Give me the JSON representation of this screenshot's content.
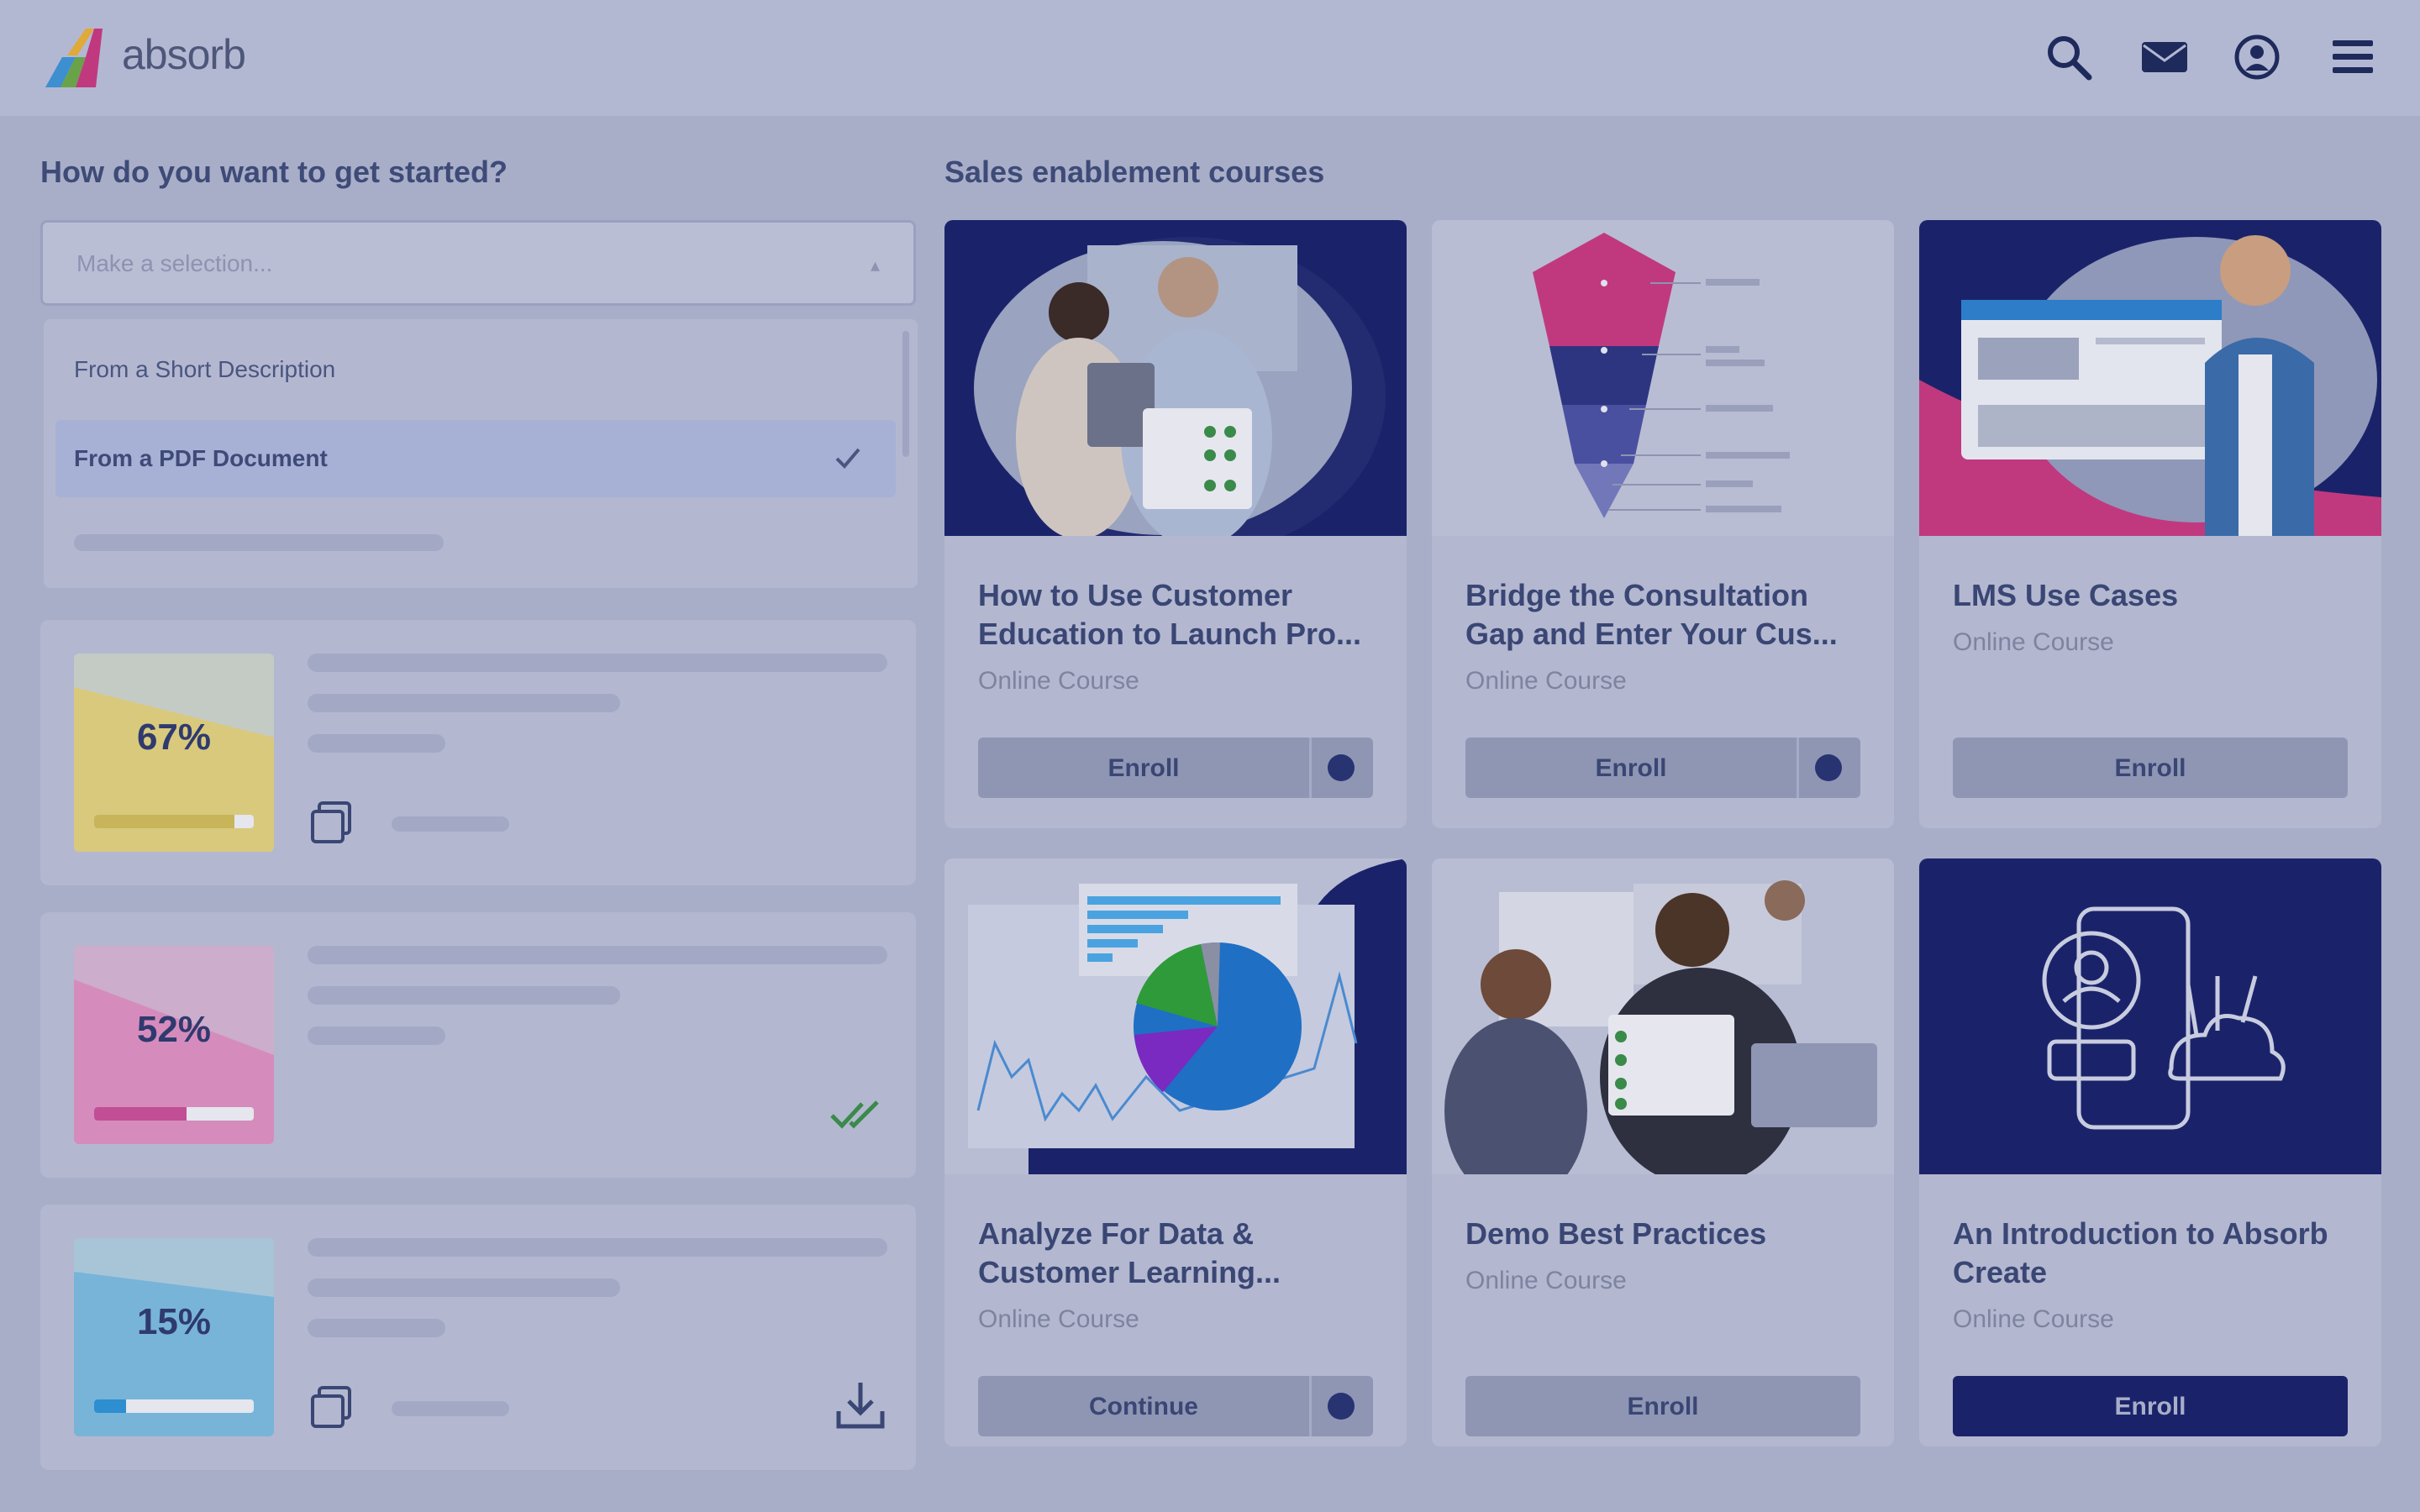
{
  "header": {
    "brand": "absorb",
    "icons": [
      "search-icon",
      "mail-icon",
      "account-icon",
      "menu-icon"
    ]
  },
  "left": {
    "heading": "How do you want to get started?",
    "select": {
      "placeholder": "Make a selection...",
      "options": [
        "From a Short Description",
        "From a PDF Document"
      ],
      "selected": "From a PDF Document"
    },
    "cards": [
      {
        "percent": "67%",
        "progress": 0.9,
        "color": "#d8c97c",
        "accent": "#c8b55a",
        "bg": "#c4cbc5"
      },
      {
        "percent": "52%",
        "progress": 0.6,
        "color": "#d58cbc",
        "accent": "#c24e95",
        "bg": "#ccadcb"
      },
      {
        "percent": "15%",
        "progress": 0.2,
        "color": "#77b4d8",
        "accent": "#2d8ed0",
        "bg": "#a8c5d8"
      }
    ]
  },
  "right": {
    "heading": "Sales enablement courses",
    "courses": [
      {
        "title": "How to Use Customer Education to Launch Pro...",
        "type": "Online Course",
        "button": "Enroll",
        "info": true
      },
      {
        "title": "Bridge the Consultation Gap and Enter Your Cus...",
        "type": "Online Course",
        "button": "Enroll",
        "info": true
      },
      {
        "title": "LMS Use Cases",
        "type": "Online Course",
        "button": "Enroll",
        "info": false
      },
      {
        "title": "Analyze For Data & Customer Learning...",
        "type": "Online Course",
        "button": "Continue",
        "info": true
      },
      {
        "title": "Demo Best Practices",
        "type": "Online Course",
        "button": "Enroll",
        "info": false
      },
      {
        "title": "An Introduction to Absorb Create",
        "type": "Online Course",
        "button": "Enroll",
        "info": false
      }
    ]
  },
  "colors": {
    "navy": "#1a236a",
    "magenta": "#c0397f",
    "overlay": "#a9aec8"
  }
}
